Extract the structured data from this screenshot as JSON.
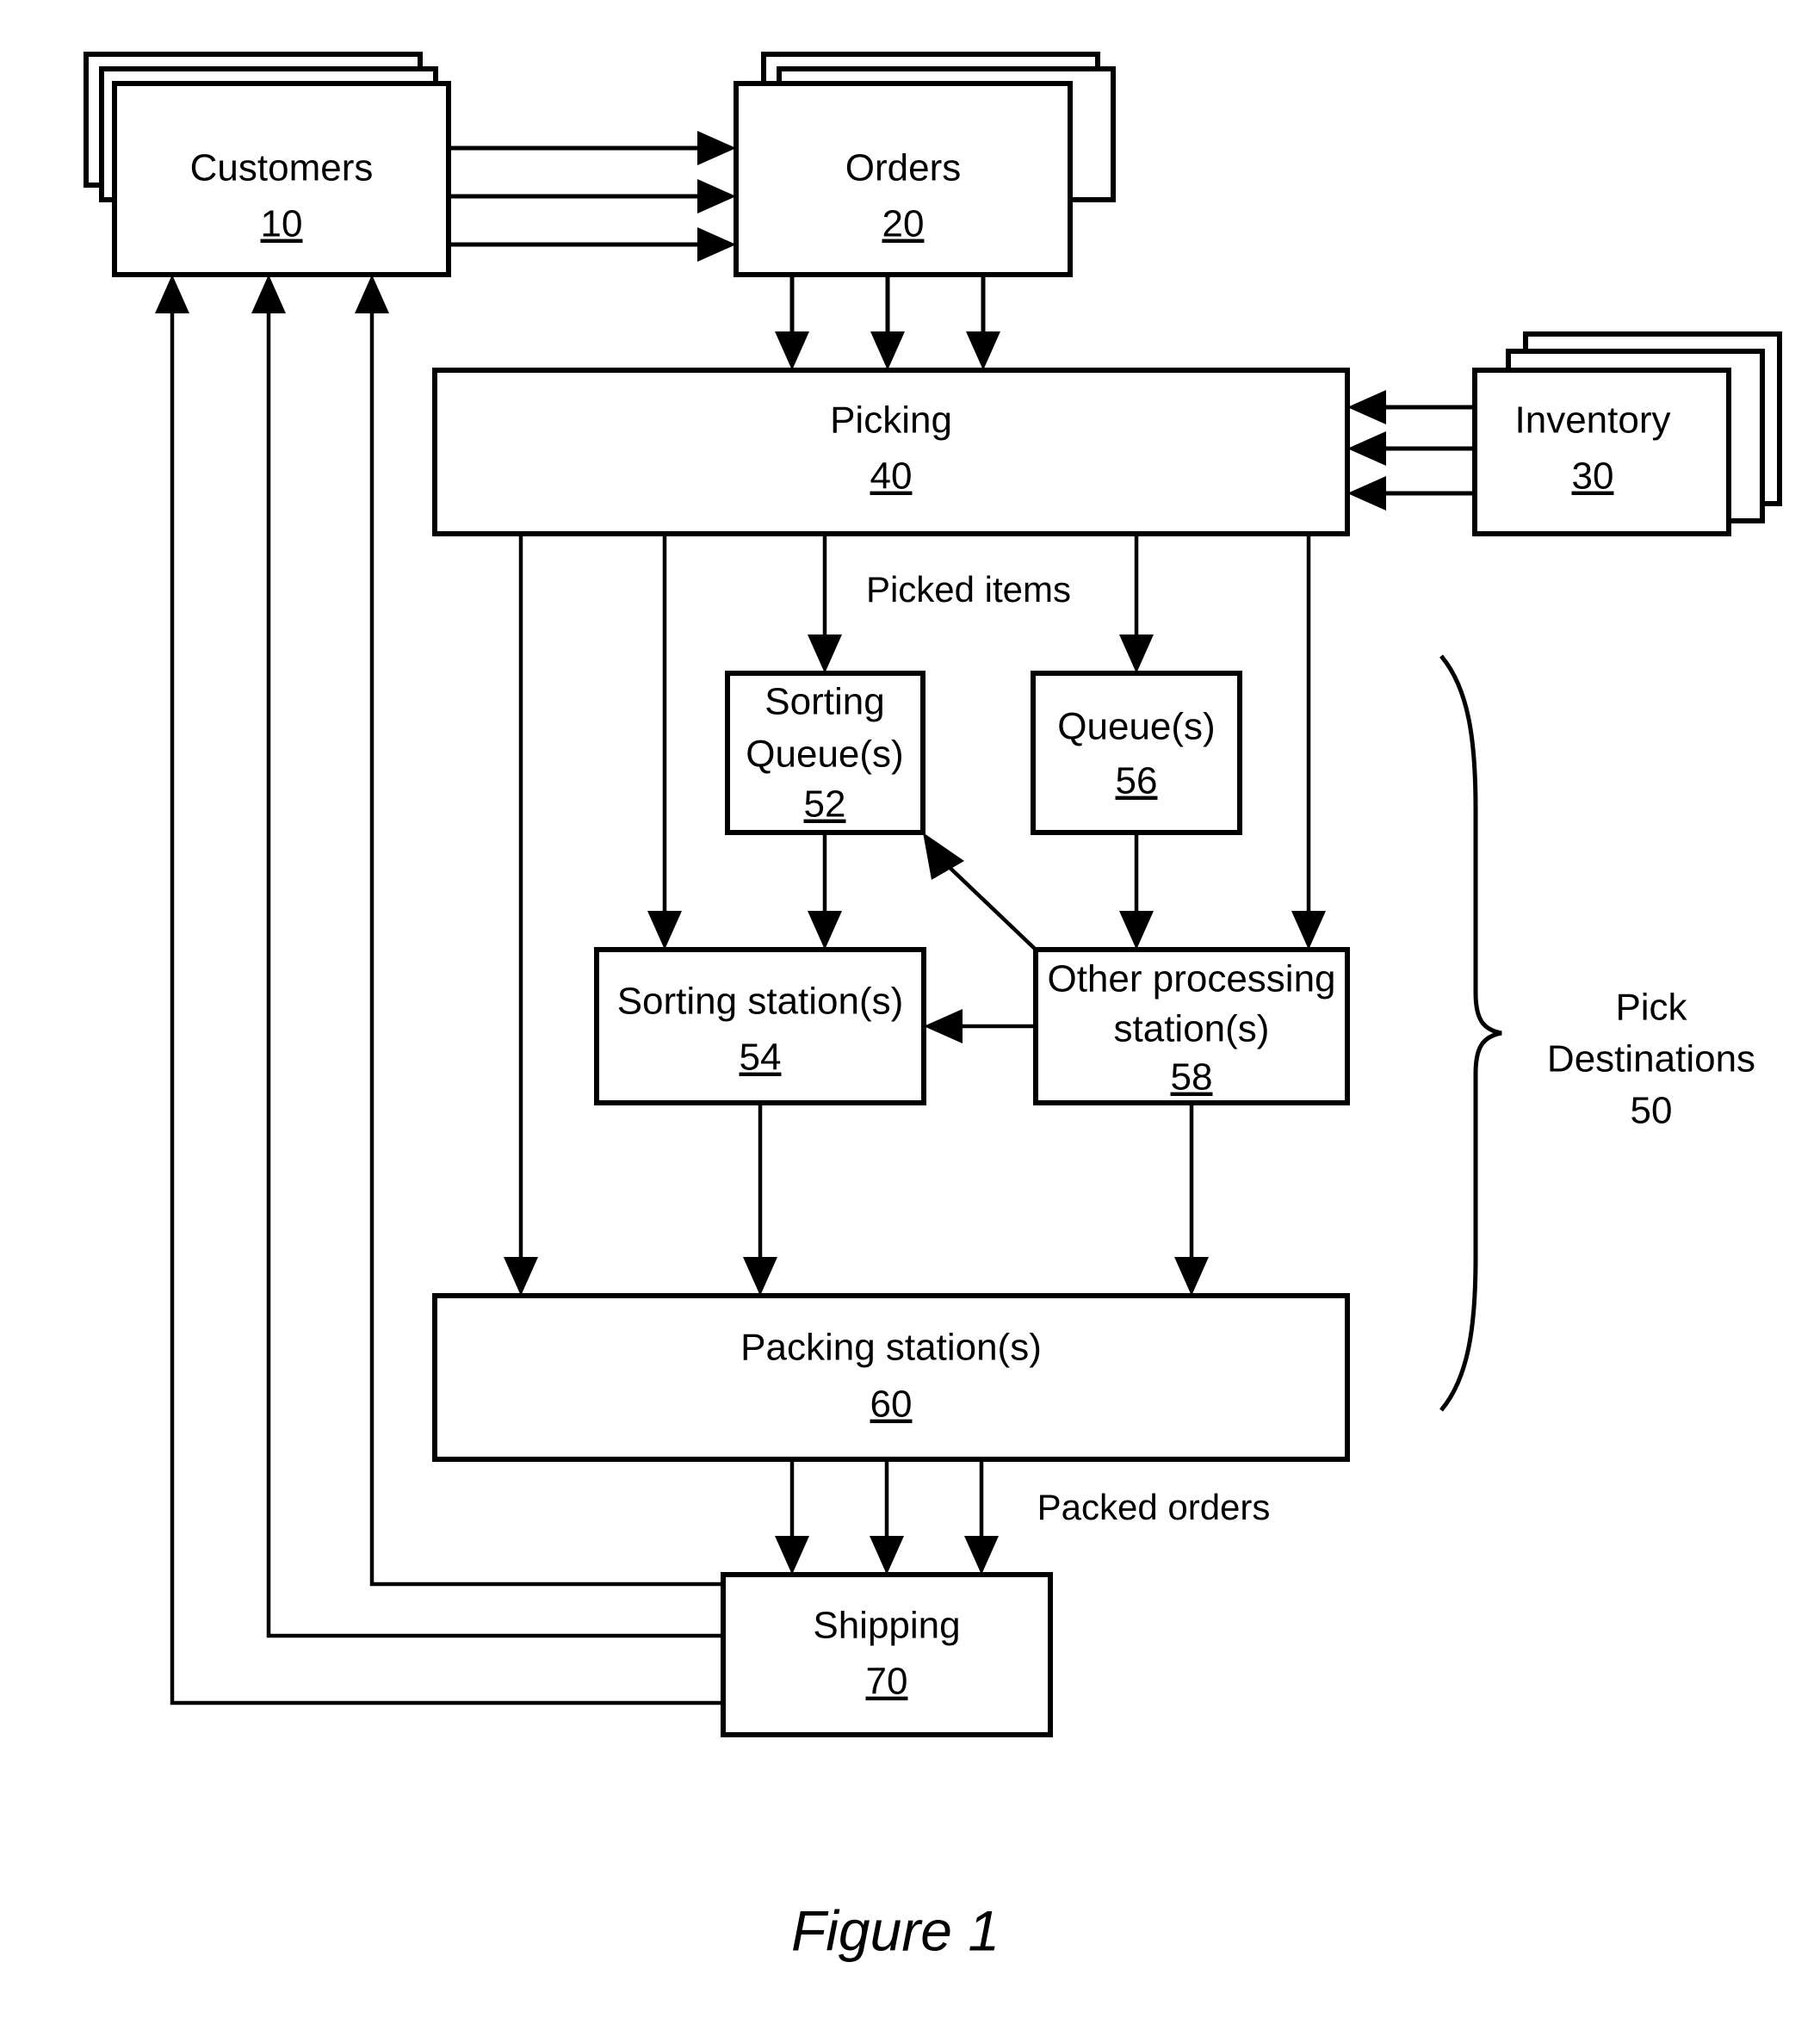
{
  "figure": {
    "caption": "Figure 1"
  },
  "nodes": {
    "customers": {
      "label": "Customers",
      "ref": "10",
      "stacked": true
    },
    "orders": {
      "label": "Orders",
      "ref": "20",
      "stacked": true
    },
    "inventory": {
      "label": "Inventory",
      "ref": "30",
      "stacked": true
    },
    "picking": {
      "label": "Picking",
      "ref": "40",
      "stacked": false
    },
    "sorting_queue": {
      "label_line1": "Sorting",
      "label_line2": "Queue(s)",
      "ref": "52",
      "stacked": false
    },
    "sorting_station": {
      "label": "Sorting station(s)",
      "ref": "54",
      "stacked": false
    },
    "queue": {
      "label": "Queue(s)",
      "ref": "56",
      "stacked": false
    },
    "other_processing": {
      "label_line1": "Other processing",
      "label_line2": "station(s)",
      "ref": "58",
      "stacked": false
    },
    "packing_station": {
      "label": "Packing station(s)",
      "ref": "60",
      "stacked": false
    },
    "shipping": {
      "label": "Shipping",
      "ref": "70",
      "stacked": false
    }
  },
  "edge_labels": {
    "picked_items": "Picked items",
    "packed_orders": "Packed orders"
  },
  "group": {
    "pick_destinations_line1": "Pick",
    "pick_destinations_line2": "Destinations",
    "pick_destinations_ref": "50"
  },
  "colors": {
    "stroke": "#000000",
    "fill": "#ffffff",
    "background": "#ffffff"
  }
}
